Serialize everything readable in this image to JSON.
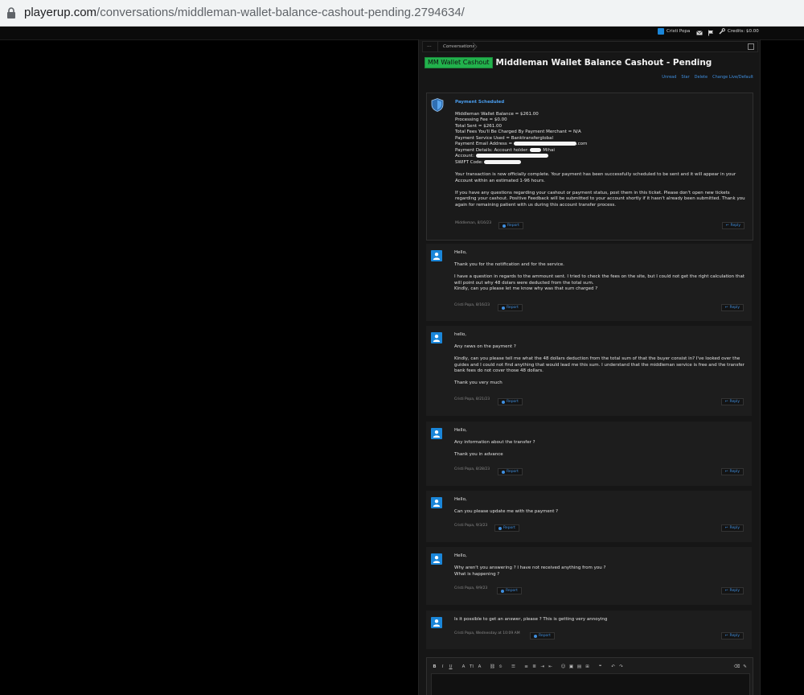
{
  "browser": {
    "url_host": "playerup.com",
    "url_path": "/conversations/middleman-wallet-balance-cashout-pending.2794634/"
  },
  "topbar": {
    "username": "Cristi Popa",
    "credits": "Credits: $0.00"
  },
  "breadcrumb": {
    "dots": "...",
    "item": "Conversations"
  },
  "thread": {
    "prefix": "MM Wallet Cashout",
    "title": "Middleman Wallet Balance Cashout - Pending",
    "actions": [
      "Unread",
      "Star",
      "Delete",
      "Change Live/Default"
    ]
  },
  "labels": {
    "report": "Report",
    "reply": "Reply"
  },
  "first_post": {
    "heading": "Payment Scheduled",
    "details": [
      "Middleman Wallet Balance = $261.00",
      "Processing Fee = $0.00",
      "Total Sent = $261.00",
      "Total Fees You'll Be Charged By Payment Merchant = N/A",
      "Payment Service Used = Banktransferglobal"
    ],
    "email_label": "Payment Email Address = ",
    "email_tail": ".com",
    "details_label": "Payment Details: Account holder: ",
    "details_tail": "Mihai",
    "account_label": "Account: ",
    "swift_label": "SWIFT Code: ",
    "para1": "Your transaction is now officially complete. Your payment has been successfully scheduled to be sent and it will appear in your Account within an estimated 1-96 hours.",
    "para2": "If you have any questions regarding your cashout or payment status, post them in this ticket. Please don't open new tickets regarding your cashout. Positive Feedback will be submitted to your account shortly if it hasn't already been submitted. Thank you again for remaining patient with us during this account transfer process.",
    "meta": "Middleman, 8/16/23"
  },
  "messages": [
    {
      "paragraphs": [
        "Hello,",
        "Thank you for the notification and for the service.",
        "I have a question in regards to the ammount sent. I tried to check the fees on the site, but I could not get the right calculation that will point out why 48 dolars were deducted from the total sum.\nKindly, can you please let me know why was that sum charged ?"
      ],
      "meta": "Cristi Popa, 8/16/23"
    },
    {
      "paragraphs": [
        "hello,",
        "Any news on the payment ?",
        "Kindly, can you please tell me what the 48 dollars deduction from the total sum of that the buyer consist in? I've looked over the guides and I could not find anything that would lead me this sum. I understand that the middleman service is free and the transfer bank fees do not cover those 48 dollars.",
        "Thank you very much"
      ],
      "meta": "Cristi Popa, 8/21/23"
    },
    {
      "paragraphs": [
        "Hello,",
        "Any information about the transfer ?",
        "Thank you in advance"
      ],
      "meta": "Cristi Popa, 8/28/23"
    },
    {
      "paragraphs": [
        "Hello,",
        "Can you please update me with the payment ?"
      ],
      "meta": "Cristi Popa, 9/3/23"
    },
    {
      "paragraphs": [
        "Hello,",
        "Why aren't you answering ? I have not received anything from you ?\nWhat is happening ?"
      ],
      "meta": "Cristi Popa, 9/9/23"
    },
    {
      "paragraphs": [
        "Is it possible to get an answer, please ? This is getting very annoying"
      ],
      "meta": "Cristi Popa, Wednesday at 10:09 AM"
    }
  ],
  "editor": {
    "tools": [
      "B",
      "I",
      "U",
      "A",
      "TI",
      "A",
      "link",
      "unlink",
      "align",
      "ul",
      "ol",
      "indent",
      "outdent",
      "smilie",
      "image",
      "media",
      "code",
      "quote",
      "undo",
      "redo"
    ]
  },
  "colors": {
    "accent": "#1a86d9",
    "link": "#3f8fe0",
    "badge": "#22b14c"
  }
}
